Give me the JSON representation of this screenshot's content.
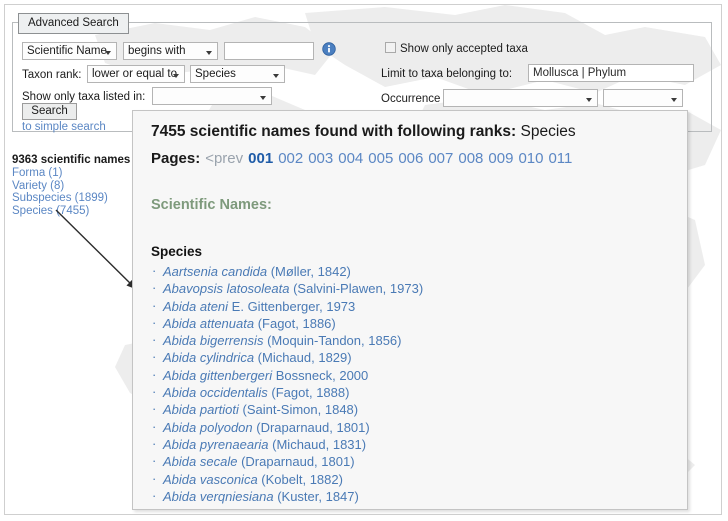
{
  "search_form": {
    "tab_label": "Advanced Search",
    "field_select": {
      "value": "Scientific Name"
    },
    "operator_select": {
      "value": "begins with"
    },
    "query_input": {
      "value": "",
      "placeholder": ""
    },
    "info_icon": "info-icon",
    "taxon_rank_label": "Taxon rank:",
    "taxon_rank_operator": {
      "value": "lower or equal to"
    },
    "taxon_rank_value": {
      "value": "Species"
    },
    "listed_in_label": "Show only taxa listed in:",
    "listed_in_select": {
      "value": ""
    },
    "accepted_taxa_label": "Show only accepted taxa",
    "accepted_taxa_checked": false,
    "limit_to_label": "Limit to taxa belonging to:",
    "limit_to_input": {
      "value": "Mollusca | Phylum"
    },
    "occurrence_label": "Occurrence",
    "occurrence_select_1": {
      "value": ""
    },
    "occurrence_select_2": {
      "value": ""
    },
    "search_button": "Search",
    "simple_search_link": "to simple search"
  },
  "names_summary": {
    "title": "9363 scientific names",
    "ranks": [
      {
        "label": "Forma (1)"
      },
      {
        "label": "Variety (8)"
      },
      {
        "label": "Subspecies (1899)"
      },
      {
        "label": "Species (7455)"
      }
    ]
  },
  "results": {
    "count": "7455",
    "heading_prefix": "7455 scientific names found with following ranks:",
    "heading_rank": " Species",
    "pages_label": "Pages:",
    "prev_label": "<prev",
    "pages": [
      "001",
      "002",
      "003",
      "004",
      "005",
      "006",
      "007",
      "008",
      "009",
      "010",
      "011"
    ],
    "current_page": "001",
    "scientific_names_heading": "Scientific Names:",
    "group_label": "Species",
    "species": [
      {
        "name": "Aartsenia candida",
        "authority": " (Møller, 1842)"
      },
      {
        "name": "Abavopsis latosoleata",
        "authority": " (Salvini-Plawen, 1973)"
      },
      {
        "name": "Abida ateni",
        "authority": " E. Gittenberger, 1973"
      },
      {
        "name": "Abida attenuata",
        "authority": " (Fagot, 1886)"
      },
      {
        "name": "Abida bigerrensis",
        "authority": " (Moquin-Tandon, 1856)"
      },
      {
        "name": "Abida cylindrica",
        "authority": " (Michaud, 1829)"
      },
      {
        "name": "Abida gittenbergeri",
        "authority": " Bossneck, 2000"
      },
      {
        "name": "Abida occidentalis",
        "authority": " (Fagot, 1888)"
      },
      {
        "name": "Abida partioti",
        "authority": " (Saint-Simon, 1848)"
      },
      {
        "name": "Abida polyodon",
        "authority": " (Draparnaud, 1801)"
      },
      {
        "name": "Abida pyrenaearia",
        "authority": " (Michaud, 1831)"
      },
      {
        "name": "Abida secale",
        "authority": " (Draparnaud, 1801)"
      },
      {
        "name": "Abida vasconica",
        "authority": " (Kobelt, 1882)"
      },
      {
        "name": "Abida verqniesiana",
        "authority": " (Kuster, 1847)"
      }
    ]
  },
  "colors": {
    "link": "#5b87c4",
    "heading_green": "#7e9a7c",
    "current_page": "#1f5ca8",
    "panel_bg": "#f7f7f7"
  }
}
